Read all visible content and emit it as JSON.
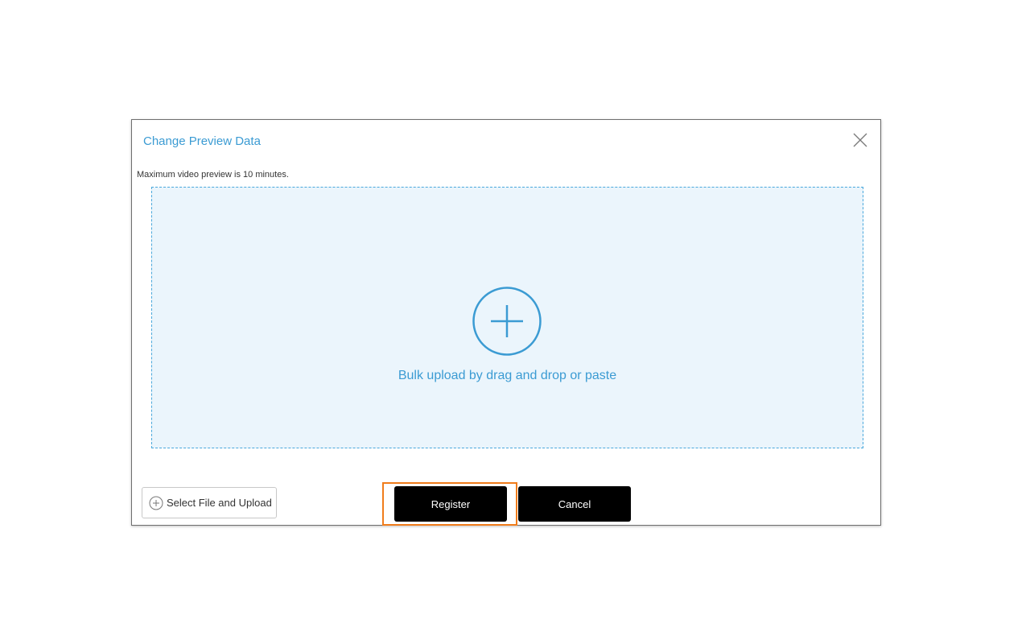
{
  "dialog": {
    "title": "Change Preview Data",
    "note": "Maximum video preview is 10 minutes.",
    "dropzone": {
      "text": "Bulk upload by drag and drop or paste",
      "icon": "plus-circle-icon"
    },
    "select_file_label": "Select File and Upload",
    "register_label": "Register",
    "cancel_label": "Cancel",
    "close_icon": "close-icon"
  },
  "colors": {
    "accent": "#3b9bd3",
    "dropzone_bg": "#ebf5fc",
    "highlight": "#f07c1b",
    "button_bg": "#000000"
  }
}
